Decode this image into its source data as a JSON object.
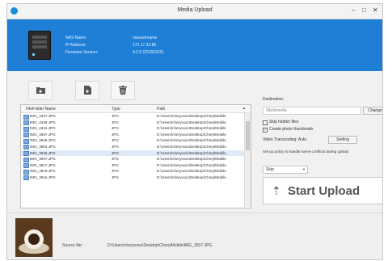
{
  "window": {
    "title": "Media Upload"
  },
  "device": {
    "name_label": "NAS Name:",
    "name_value": "nasusername",
    "ip_label": "IP Address:",
    "ip_value": "172.17.32.86",
    "fw_label": "Firmware Version:",
    "fw_value": "4.2.0 (20150310)"
  },
  "toolbar": {
    "add_folder_icon": "folder-add-icon",
    "add_file_icon": "file-add-icon",
    "delete_icon": "trash-icon"
  },
  "filelist": {
    "columns": [
      "FileFolder Name",
      "Type",
      "Path"
    ],
    "rows": [
      {
        "name": "IMG_4337.JPG",
        "type": "JPG",
        "path": "D:\\Users\\cheryxxxx\\Desktop\\CherylMobile"
      },
      {
        "name": "IMG_4339.JPG",
        "type": "JPG",
        "path": "D:\\Users\\cheryxxxx\\Desktop\\CherylMobile"
      },
      {
        "name": "IMG_4322.JPG",
        "type": "JPG",
        "path": "D:\\Users\\cheryxxxx\\Desktop\\CherylMobile"
      },
      {
        "name": "IMG_3997.JPG",
        "type": "JPG",
        "path": "D:\\Users\\cheryxxxx\\Desktop\\CherylMobile"
      },
      {
        "name": "IMG_3946.JPG",
        "type": "JPG",
        "path": "D:\\Users\\cheryxxxx\\Desktop\\CherylMobile"
      },
      {
        "name": "IMG_3904.JPG",
        "type": "JPG",
        "path": "D:\\Users\\cheryxxxx\\Desktop\\CherylMobile"
      },
      {
        "name": "IMG_3945.JPG",
        "type": "JPG",
        "path": "D:\\Users\\cheryxxxx\\Desktop\\CherylMobile"
      },
      {
        "name": "IMG_3937.JPG",
        "type": "JPG",
        "path": "D:\\Users\\cheryxxxx\\Desktop\\CherylMobile"
      },
      {
        "name": "IMG_3917.JPG",
        "type": "JPG",
        "path": "D:\\Users\\cheryxxxx\\Desktop\\CherylMobile"
      },
      {
        "name": "IMG_3919.JPG",
        "type": "JPG",
        "path": "D:\\Users\\cheryxxxx\\Desktop\\CherylMobile"
      },
      {
        "name": "IMG_3916.JPG",
        "type": "JPG",
        "path": "D:\\Users\\cheryxxxx\\Desktop\\CherylMobile"
      }
    ],
    "selected_row": 6
  },
  "options": {
    "destination_label": "Destination:",
    "destination_value": "/Multimedia",
    "change_label": "Change",
    "skip_hidden_label": "Skip hidden files",
    "skip_hidden_checked": false,
    "thumbs_label": "Create photo thumbnails",
    "thumbs_checked": true,
    "transcoding_label": "Video Transcoding: Auto",
    "setting_label": "Setting",
    "conflict_label": "Set up policy to handle name conflicts during upload",
    "policy_value": "Skip",
    "start_label": "Start Upload"
  },
  "footer": {
    "source_label": "Source file:",
    "source_value": "D:\\Users\\cheryxxxx\\Desktop\\CherylMobile\\IMG_3937.JPG"
  },
  "colors": {
    "banner": "#1f7fd6",
    "selected_row": "#dfeaf7"
  }
}
